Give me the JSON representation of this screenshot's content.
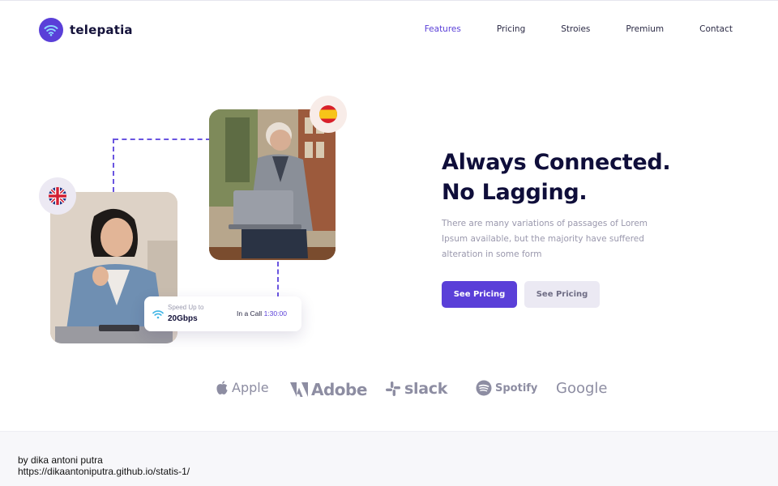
{
  "brand": {
    "name": "telepatia",
    "logo_icon": "wifi-icon",
    "accent_color": "#5a3fd8"
  },
  "nav": {
    "items": [
      {
        "label": "Features",
        "active": true
      },
      {
        "label": "Pricing",
        "active": false
      },
      {
        "label": "Stroies",
        "active": false
      },
      {
        "label": "Premium",
        "active": false
      },
      {
        "label": "Contact",
        "active": false
      }
    ]
  },
  "hero": {
    "headline_line1": "Always Connected.",
    "headline_line2": "No Lagging.",
    "description": "There are many variations of passages of Lorem Ipsum available, but the majority have suffered alteration in some form",
    "primary_button": "See Pricing",
    "secondary_button": "See Pricing"
  },
  "call_card": {
    "speed_label": "Speed Up to",
    "speed_value": "20Gbps",
    "call_label": "In a Call",
    "call_time": "1:30:00"
  },
  "flags": [
    "spain-flag-icon",
    "uk-flag-icon"
  ],
  "brands": [
    "Apple",
    "Adobe",
    "slack",
    "Spotify",
    "Google"
  ],
  "footer": {
    "author": "by dika antoni putra",
    "url": "https://dikaantoniputra.github.io/statis-1/"
  }
}
